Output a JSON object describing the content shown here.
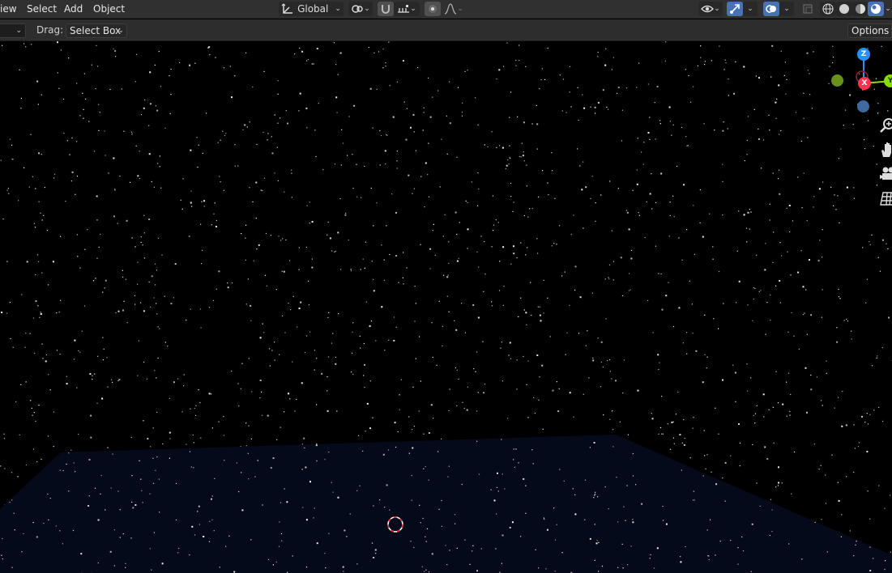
{
  "header": {
    "menus": [
      {
        "label": "iew"
      },
      {
        "label": "Select"
      },
      {
        "label": "Add"
      },
      {
        "label": "Object"
      }
    ],
    "transform_orientation": "Global"
  },
  "tool_settings": {
    "drag_label": "Drag:",
    "drag_value": "Select Box",
    "options_label": "Options"
  },
  "gizmo": {
    "z": "Z",
    "x": "X",
    "y": "Y"
  },
  "colors": {
    "header_bg": "#303030",
    "accent": "#4772b3",
    "axis_x": "#ff3352",
    "axis_y": "#8bdc00",
    "axis_z": "#2890ff",
    "ground": "#050a1a"
  }
}
